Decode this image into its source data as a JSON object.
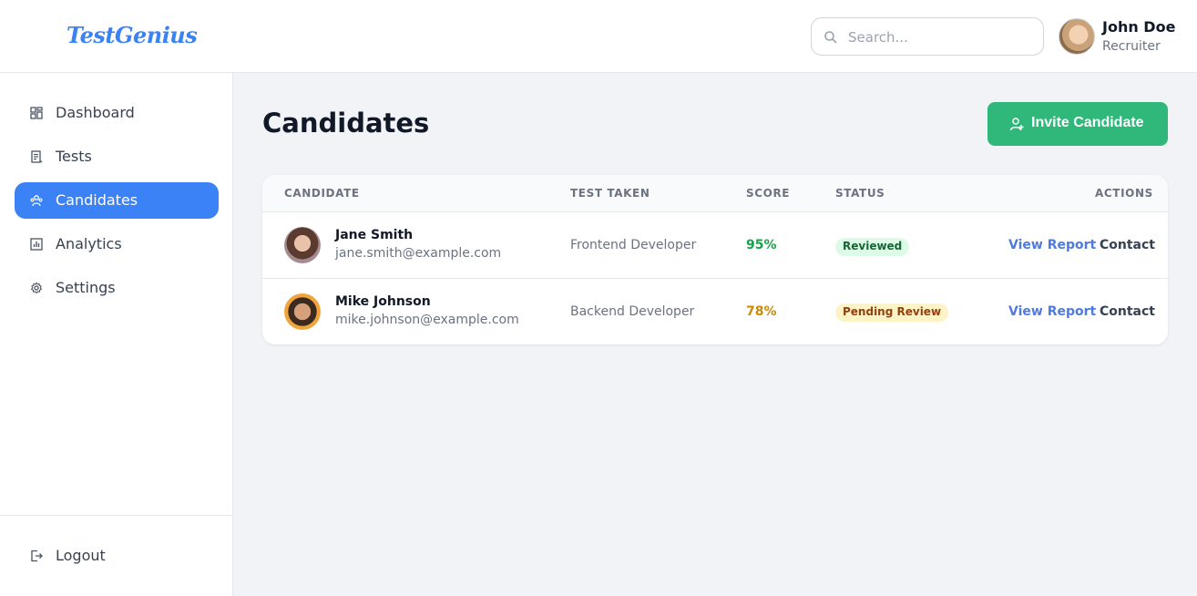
{
  "header": {
    "logo": "TestGenius",
    "search_placeholder": "Search...",
    "user": {
      "name": "John Doe",
      "role": "Recruiter"
    }
  },
  "sidebar": {
    "items": [
      {
        "label": "Dashboard",
        "icon": "dashboard-icon",
        "active": false
      },
      {
        "label": "Tests",
        "icon": "tests-icon",
        "active": false
      },
      {
        "label": "Candidates",
        "icon": "candidates-icon",
        "active": true
      },
      {
        "label": "Analytics",
        "icon": "analytics-icon",
        "active": false
      },
      {
        "label": "Settings",
        "icon": "settings-icon",
        "active": false
      }
    ],
    "logout_label": "Logout"
  },
  "main": {
    "title": "Candidates",
    "invite_button": "Invite Candidate",
    "table": {
      "headers": [
        "CANDIDATE",
        "TEST TAKEN",
        "SCORE",
        "STATUS",
        "ACTIONS"
      ],
      "rows": [
        {
          "name": "Jane Smith",
          "email": "jane.smith@example.com",
          "test": "Frontend Developer",
          "score": "95%",
          "status": "Reviewed",
          "view": "View Report",
          "contact": "Contact"
        },
        {
          "name": "Mike Johnson",
          "email": "mike.johnson@example.com",
          "test": "Backend Developer",
          "score": "78%",
          "status": "Pending Review",
          "view": "View Report",
          "contact": "Contact"
        }
      ]
    }
  },
  "colors": {
    "accent": "#3b82f6",
    "invite": "#2fb87a",
    "score_high": "#16a34a",
    "score_mid": "#ca8a04",
    "link": "#4f7ae0"
  }
}
